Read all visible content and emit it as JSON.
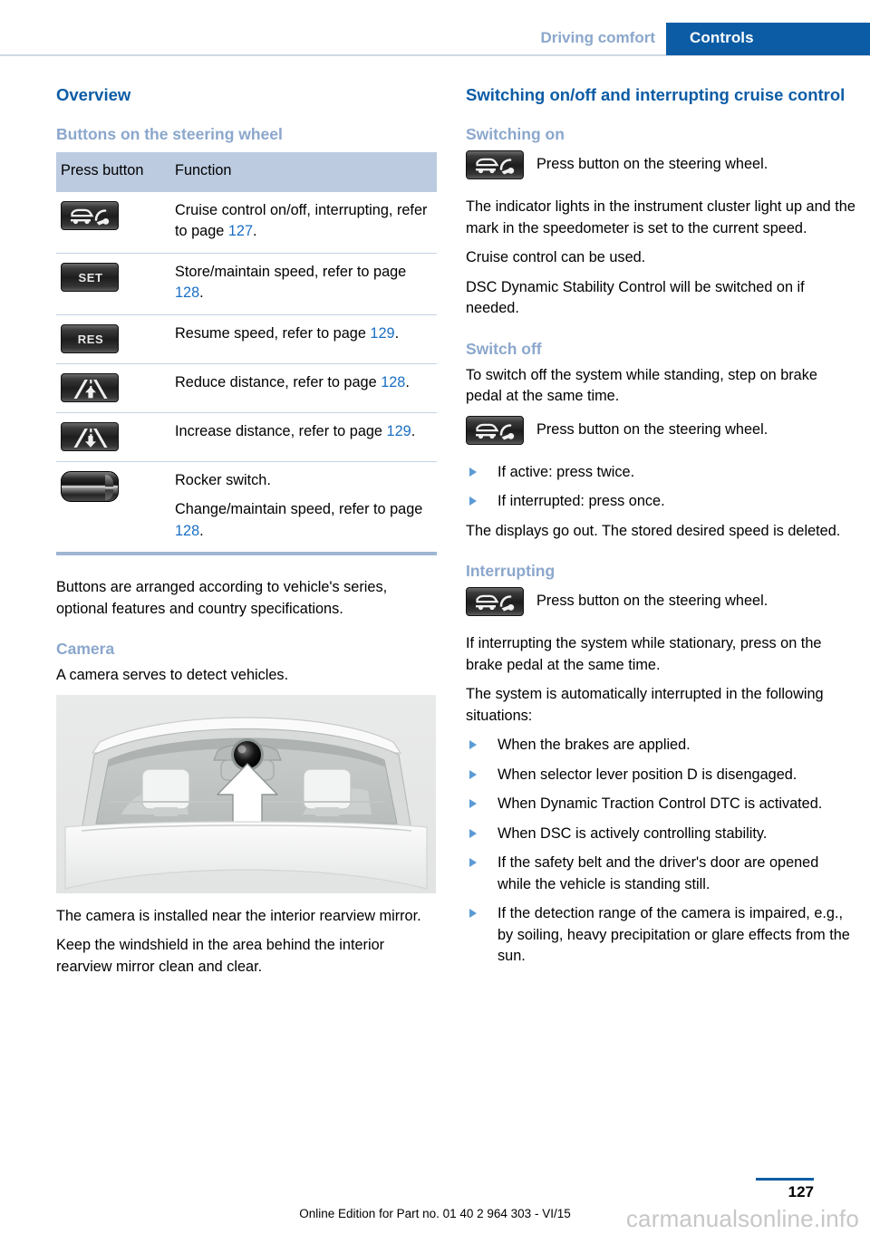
{
  "header": {
    "chapter": "Driving comfort",
    "active_tab": "Controls",
    "accent_blue": "#0c5ca5",
    "muted_blue": "#8ba7cc"
  },
  "left": {
    "h1_overview": "Overview",
    "h2_buttons": "Buttons on the steering wheel",
    "table": {
      "headers": [
        "Press button",
        "Function"
      ],
      "rows": [
        {
          "icon": "cruise-control-icon",
          "icon_label": "",
          "text_before": "Cruise control on/off, interrupting, refer to page ",
          "page": "127",
          "text_after": "."
        },
        {
          "icon": "set-button-icon",
          "icon_label": "SET",
          "text_before": "Store/maintain speed, refer to page ",
          "page": "128",
          "text_after": "."
        },
        {
          "icon": "res-button-icon",
          "icon_label": "RES",
          "text_before": "Resume speed, refer to page ",
          "page": "129",
          "text_after": "."
        },
        {
          "icon": "reduce-distance-icon",
          "icon_label": "",
          "text_before": "Reduce distance, refer to page ",
          "page": "128",
          "text_after": "."
        },
        {
          "icon": "increase-distance-icon",
          "icon_label": "",
          "text_before": "Increase distance, refer to page ",
          "page": "129",
          "text_after": "."
        },
        {
          "icon": "rocker-switch-icon",
          "icon_label": "",
          "line1": "Rocker switch.",
          "text_before": "Change/maintain speed, refer to page ",
          "page": "128",
          "text_after": "."
        }
      ]
    },
    "para_arranged": "Buttons are arranged according to vehicle's series, optional features and country specifications.",
    "h2_camera": "Camera",
    "para_camera_serves": "A camera serves to detect vehicles.",
    "figure_caption_alt": "Windshield interior view showing camera location near rearview mirror",
    "para_camera_installed": "The camera is installed near the interior rearview mirror.",
    "para_keep_windshield": "Keep the windshield in the area behind the interior rearview mirror clean and clear."
  },
  "right": {
    "h1_switching": "Switching on/off and interrupting cruise control",
    "h2_switching_on": "Switching on",
    "press_button_1": "Press button on the steering wheel.",
    "para_indicator": "The indicator lights in the instrument cluster light up and the mark in the speedometer is set to the current speed.",
    "para_cruise_used": "Cruise control can be used.",
    "para_dsc": "DSC Dynamic Stability Control will be switched on if needed.",
    "h2_switch_off": "Switch off",
    "para_to_switch_off": "To switch off the system while standing, step on brake pedal at the same time.",
    "press_button_2": "Press button on the steering wheel.",
    "bullets_switch_off": [
      "If active: press twice.",
      "If interrupted: press once."
    ],
    "para_displays_go_out": "The displays go out. The stored desired speed is deleted.",
    "h2_interrupting": "Interrupting",
    "press_button_3": "Press button on the steering wheel.",
    "para_if_interrupting": "If interrupting the system while stationary, press on the brake pedal at the same time.",
    "para_automatically": "The system is automatically interrupted in the following situations:",
    "bullets_interrupt": [
      "When the brakes are applied.",
      "When selector lever position D is disengaged.",
      "When Dynamic Traction Control DTC is activated.",
      "When DSC is actively controlling stability.",
      "If the safety belt and the driver's door are opened while the vehicle is standing still.",
      "If the detection range of the camera is impaired, e.g., by soiling, heavy precipitation or glare effects from the sun."
    ]
  },
  "footer": {
    "page_number": "127",
    "edition": "Online Edition for Part no. 01 40 2 964 303 - VI/15",
    "watermark": "carmanualsonline.info"
  }
}
